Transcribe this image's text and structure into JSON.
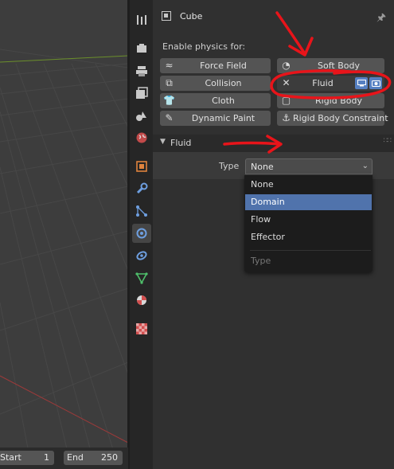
{
  "timeline": {
    "start_label": "Start",
    "start_value": "1",
    "end_label": "End",
    "end_value": "250"
  },
  "header": {
    "object_name": "Cube"
  },
  "physics": {
    "enable_label": "Enable physics for:",
    "buttons": [
      {
        "label": "Force Field"
      },
      {
        "label": "Soft Body"
      },
      {
        "label": "Collision"
      },
      {
        "label": "Fluid"
      },
      {
        "label": "Cloth"
      },
      {
        "label": "Rigid Body"
      },
      {
        "label": "Dynamic Paint"
      },
      {
        "label": "Rigid Body Constraint"
      }
    ]
  },
  "fluid_panel": {
    "title": "Fluid",
    "type_label": "Type",
    "type_value": "None",
    "dropdown": {
      "options": [
        "None",
        "Domain",
        "Flow",
        "Effector"
      ],
      "highlighted": "Domain",
      "title": "Type"
    }
  },
  "colors": {
    "highlight": "#5073ac",
    "annotation": "#e8141a",
    "x_axis_line": "#9c3a3a",
    "y_axis_line": "#6b8f2b"
  }
}
